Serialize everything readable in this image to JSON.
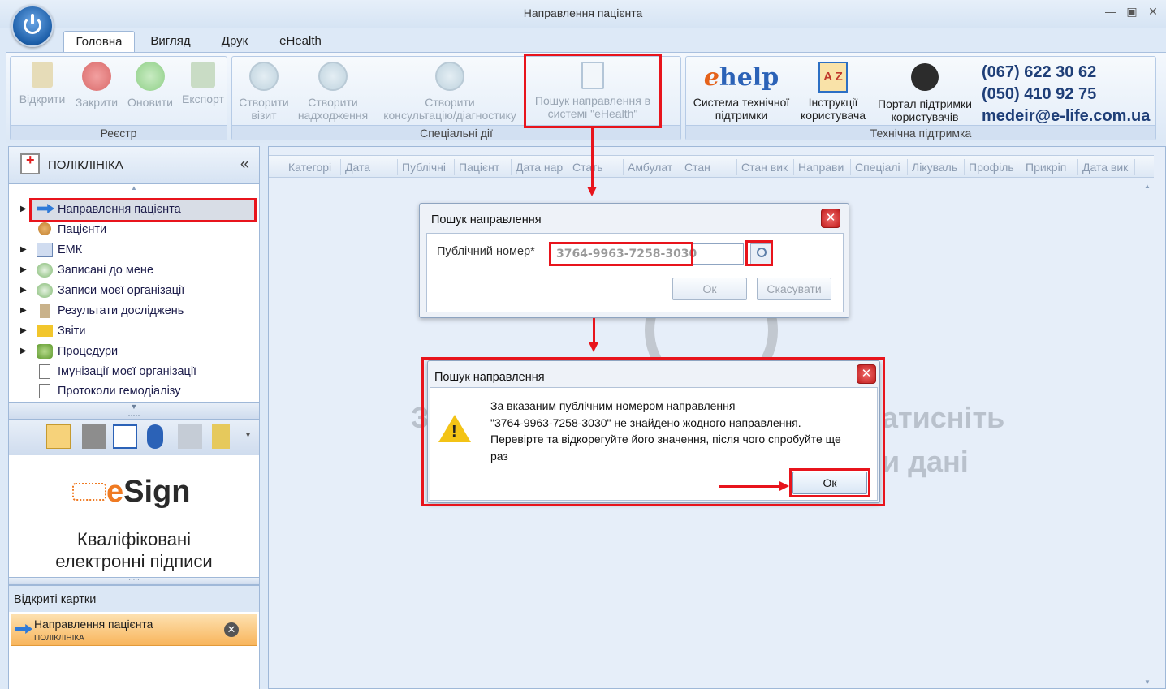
{
  "window": {
    "title": "Направлення пацієнта",
    "controls": [
      "minimize",
      "maximize",
      "close"
    ]
  },
  "tabs": [
    {
      "label": "Головна",
      "active": true
    },
    {
      "label": "Вигляд",
      "active": false
    },
    {
      "label": "Друк",
      "active": false
    },
    {
      "label": "eHealth",
      "active": false
    }
  ],
  "ribbon": {
    "registry": {
      "label": "Реєстр",
      "buttons": [
        {
          "label": "Відкрити",
          "icon": "book-icon",
          "enabled": false
        },
        {
          "label": "Закрити",
          "icon": "close-circle-icon",
          "enabled": false
        },
        {
          "label": "Оновити",
          "icon": "refresh-icon",
          "enabled": false
        },
        {
          "label": "Експорт",
          "icon": "export-icon",
          "enabled": false
        }
      ]
    },
    "special": {
      "label": "Спеціальні дії",
      "buttons": [
        {
          "label": "Створити візит",
          "line1": "Створити",
          "line2": "візит",
          "icon": "bed-icon",
          "enabled": false
        },
        {
          "label": "Створити надходження",
          "line1": "Створити",
          "line2": "надходження",
          "icon": "bed-icon",
          "enabled": false
        },
        {
          "label": "Створити консультацію/діагностику",
          "line1": "Створити",
          "line2": "консультацію/діагностику",
          "icon": "doctor-icon",
          "enabled": false
        },
        {
          "label": "Пошук направлення в системі \"eHealth\"",
          "line1": "Пошук направлення в",
          "line2": "системі \"eHealth\"",
          "icon": "search-document-icon",
          "enabled": false
        }
      ]
    },
    "support": {
      "label": "Технічна підтримка",
      "buttons": [
        {
          "line1": "Система технічної",
          "line2": "підтримки",
          "logo": "help",
          "logo_e": "e"
        },
        {
          "line1": "Інструкції",
          "line2": "користувача",
          "icon": "az-book-icon"
        },
        {
          "line1": "Портал підтримки",
          "line2": "користувачів",
          "icon": "headset-icon"
        }
      ],
      "contacts": [
        "(067) 622 30 62",
        "(050) 410 92 75",
        "medeir@e-life.com.ua"
      ]
    }
  },
  "left_panel": {
    "header": "ПОЛІКЛІНІКА",
    "tree": [
      {
        "label": "Направлення пацієнта",
        "icon": "arrow-right-icon",
        "expandable": true,
        "selected": true
      },
      {
        "label": "Пацієнти",
        "icon": "patients-icon",
        "expandable": false
      },
      {
        "label": "ЕМК",
        "icon": "emk-icon",
        "expandable": true
      },
      {
        "label": "Записані до мене",
        "icon": "schedule-icon",
        "expandable": true
      },
      {
        "label": "Записи моєї організації",
        "icon": "schedule-icon",
        "expandable": true
      },
      {
        "label": "Результати досліджень",
        "icon": "hourglass-icon",
        "expandable": true
      },
      {
        "label": "Звіти",
        "icon": "folder-icon",
        "expandable": true
      },
      {
        "label": "Процедури",
        "icon": "procedures-icon",
        "expandable": true
      },
      {
        "label": "Імунізації моєї організації",
        "icon": "document-icon",
        "expandable": false
      },
      {
        "label": "Протоколи гемодіалізу",
        "icon": "document-icon",
        "expandable": false
      }
    ],
    "esign": {
      "logo_e": "e",
      "logo_rest": "Sign",
      "line1": "Кваліфіковані",
      "line2": "електронні підписи"
    },
    "open_cards": {
      "header": "Відкриті картки",
      "items": [
        {
          "title": "Направлення пацієнта",
          "subtitle": "ПОЛІКЛІНІКА"
        }
      ]
    }
  },
  "grid": {
    "columns": [
      "Категорі",
      "Дата",
      "Публічні",
      "Пацієнт",
      "Дата нар",
      "Стать",
      "Амбулат",
      "Стан",
      "Стан вик",
      "Направи",
      "Спеціалі",
      "Лікуваль",
      "Профіль",
      "Прикріп",
      "Дата вик"
    ],
    "background_text": [
      "З",
      "атисніть",
      "и дані"
    ]
  },
  "search_dialog": {
    "title": "Пошук направлення",
    "field_label": "Публічний номер*",
    "field_value": "3764-9963-7258-3030",
    "ok": "Ок",
    "cancel": "Скасувати"
  },
  "error_dialog": {
    "title": "Пошук направлення",
    "message_lines": [
      "За вказаним публічним номером направлення",
      "\"3764-9963-7258-3030\" не знайдено жодного направлення.",
      "Перевірте та відкорегуйте його значення, після чого спробуйте ще",
      "раз"
    ],
    "ok": "Ок"
  },
  "colors": {
    "highlight": "#e8141c",
    "card": "#f8b55c",
    "accent": "#2b62b7"
  }
}
